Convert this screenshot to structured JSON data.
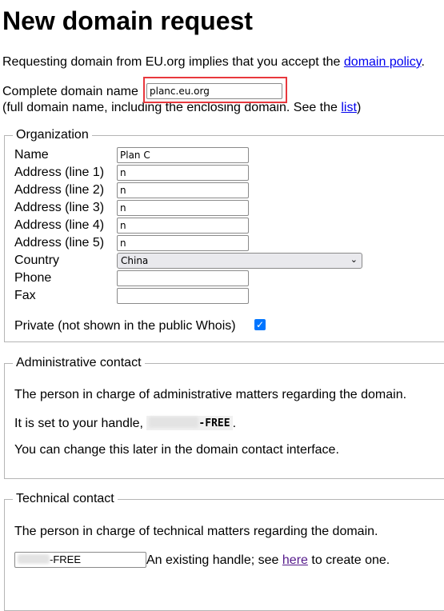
{
  "page": {
    "title": "New domain request",
    "intro_text": "Requesting domain from EU.org implies that you accept the ",
    "policy_link": "domain policy",
    "intro_end": ".",
    "domain_label": "Complete domain name",
    "domain_value": "planc.eu.org",
    "domain_hint": "(full domain name, including the enclosing domain. See the ",
    "list_link": "list",
    "domain_hint_end": ")"
  },
  "organization": {
    "legend": "Organization",
    "fields": [
      {
        "label": "Name",
        "value": "Plan C"
      },
      {
        "label": "Address (line 1)",
        "value": "n"
      },
      {
        "label": "Address (line 2)",
        "value": "n"
      },
      {
        "label": "Address (line 3)",
        "value": "n"
      },
      {
        "label": "Address (line 4)",
        "value": "n"
      },
      {
        "label": "Address (line 5)",
        "value": "n"
      }
    ],
    "country_label": "Country",
    "country_value": "China",
    "phone_label": "Phone",
    "phone_value": "",
    "fax_label": "Fax",
    "fax_value": "",
    "private_label": "Private (not shown in the public Whois)",
    "private_checked": true
  },
  "admin": {
    "legend": "Administrative contact",
    "desc": "The person in charge of administrative matters regarding the domain.",
    "handle_prefix": "It is set to your handle, ",
    "handle_suffix": "-FREE",
    "handle_end": ".",
    "change_note": "You can change this later in the domain contact interface."
  },
  "tech": {
    "legend": "Technical contact",
    "desc": "The person in charge of technical matters regarding the domain.",
    "handle_value_suffix": "-FREE",
    "existing_text": "An existing handle; see ",
    "here_link": "here",
    "existing_end": " to create one."
  },
  "colors": {
    "highlight": "#e8383d",
    "checkbox": "#0075ff",
    "link": "#0000ee",
    "visited_link": "#551a8b"
  }
}
